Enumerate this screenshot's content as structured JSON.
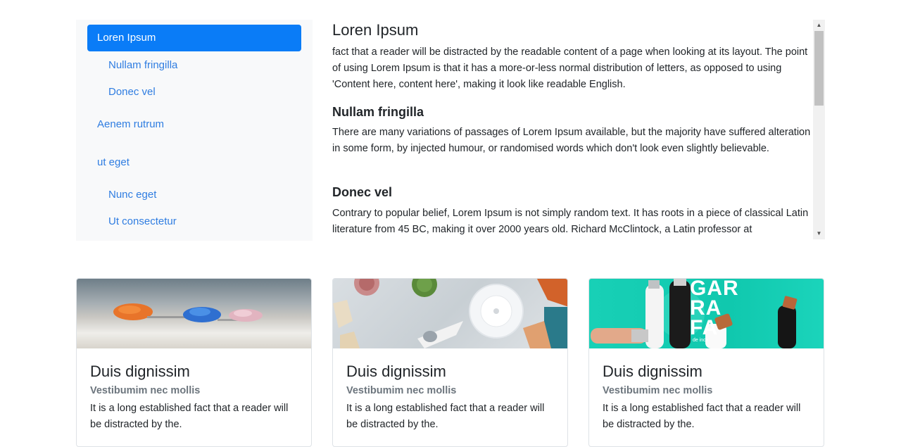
{
  "nav": {
    "items": [
      {
        "label": "Loren Ipsum",
        "active": true,
        "level": 0
      },
      {
        "label": "Nullam fringilla",
        "active": false,
        "level": 1
      },
      {
        "label": "Donec vel",
        "active": false,
        "level": 1
      },
      {
        "label": "Aenem rutrum",
        "active": false,
        "level": 0
      },
      {
        "label": "ut eget",
        "active": false,
        "level": 0
      },
      {
        "label": "Nunc eget",
        "active": false,
        "level": 1
      },
      {
        "label": "Ut consectetur",
        "active": false,
        "level": 1
      }
    ]
  },
  "content": {
    "sections": [
      {
        "heading": "Loren Ipsum",
        "text": "fact that a reader will be distracted by the readable content of a page when looking at its layout. The point of using Lorem Ipsum is that it has a more-or-less normal distribution of letters, as opposed to using 'Content here, content here', making it look like readable English."
      },
      {
        "heading": "Nullam fringilla",
        "text": "There are many variations of passages of Lorem Ipsum available, but the majority have suffered alteration in some form, by injected humour, or randomised words which don't look even slightly believable."
      },
      {
        "heading": "Donec vel",
        "text": "Contrary to popular belief, Lorem Ipsum is not simply random text. It has roots in a piece of classical Latin literature from 45 BC, making it over 2000 years old. Richard McClintock, a Latin professor at"
      }
    ]
  },
  "cards": [
    {
      "title": "Duis dignissim",
      "subtitle": "Vestibumim nec mollis",
      "text": "It is a long established fact that a reader will be distracted by the."
    },
    {
      "title": "Duis dignissim",
      "subtitle": "Vestibumim nec mollis",
      "text": "It is a long established fact that a reader will be distracted by the."
    },
    {
      "title": "Duis dignissim",
      "subtitle": "Vestibumim nec mollis",
      "text": "It is a long established fact that a reader will be distracted by the."
    }
  ],
  "card3_logo": {
    "line1": "GAR",
    "line2": "RA",
    "line3": "FA",
    "tagline": "de inox"
  },
  "colors": {
    "accent": "#0a7cf7",
    "link": "#2f7de1",
    "muted": "#6c757d",
    "sidebar_bg": "#f8f9fa"
  },
  "icons": {
    "scroll_up": "triangle-up",
    "scroll_down": "triangle-down"
  }
}
